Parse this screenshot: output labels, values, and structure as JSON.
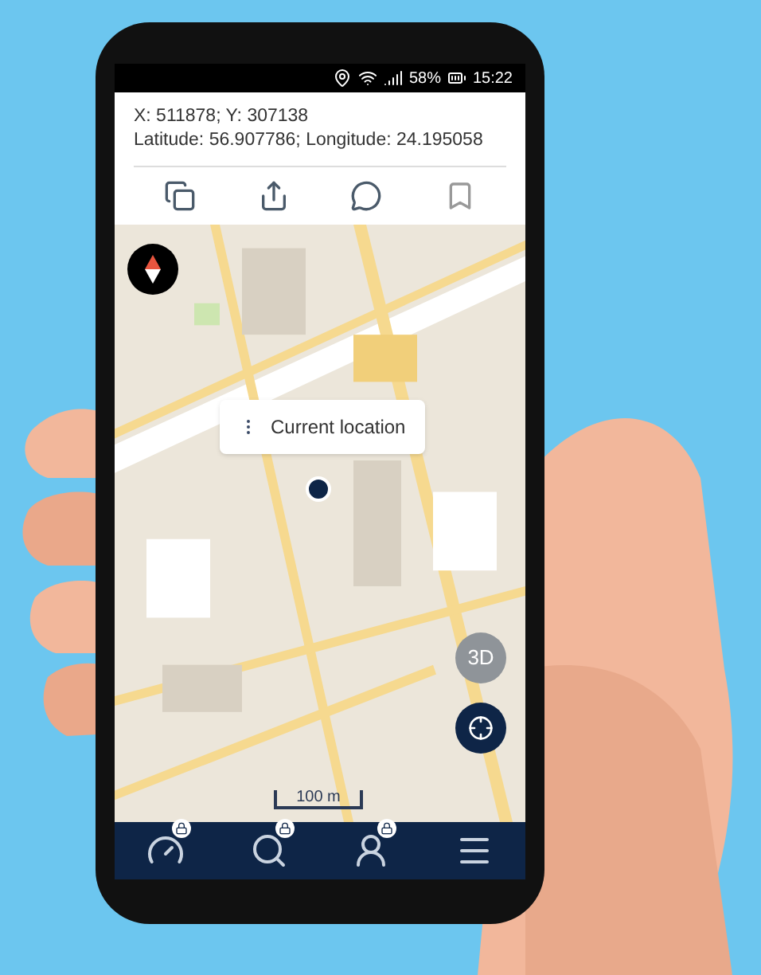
{
  "status_bar": {
    "battery": "58%",
    "time": "15:22"
  },
  "coordinates": {
    "xy": "X: 511878; Y: 307138",
    "latlon": "Latitude: 56.907786; Longitude: 24.195058"
  },
  "map": {
    "popup": "Current location",
    "button_3d": "3D",
    "scale": "100 m"
  },
  "nav_items": [
    {
      "kind": "gauge",
      "locked": true
    },
    {
      "kind": "search",
      "locked": true
    },
    {
      "kind": "person",
      "locked": true
    },
    {
      "kind": "menu",
      "locked": false
    }
  ]
}
